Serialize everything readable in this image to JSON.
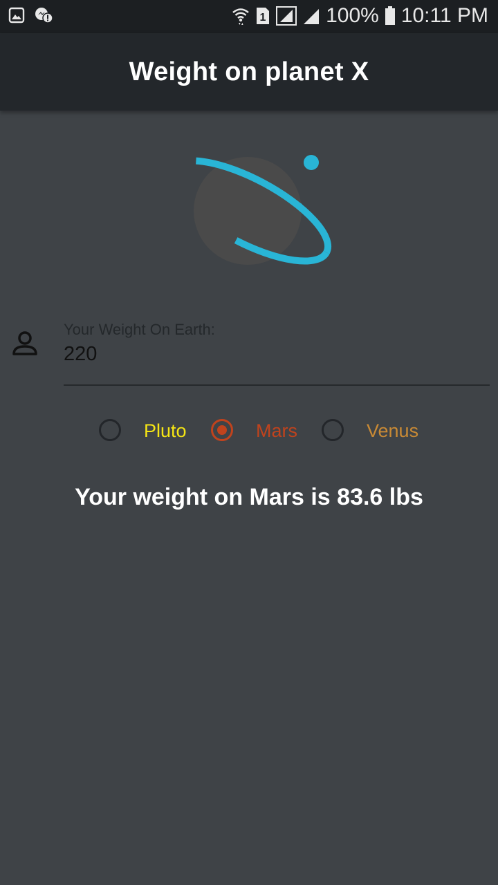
{
  "status_bar": {
    "battery_percent": "100%",
    "time": "10:11 PM",
    "sim_slot": "1",
    "left_icons": [
      "image-notification-icon",
      "messenger-alert-icon"
    ],
    "right_icons": [
      "wifi-icon",
      "sim-1-icon",
      "signal-icon",
      "signal-icon",
      "battery-icon"
    ]
  },
  "app_bar": {
    "title": "Weight on planet X"
  },
  "logo": {
    "icon": "planet-icon",
    "colors": {
      "ring": "#29b5d6",
      "planet": "#4a4a4a",
      "moon": "#29b5d6"
    }
  },
  "weight_field": {
    "icon": "person-icon",
    "label": "Your Weight On Earth:",
    "value": "220"
  },
  "planet_options": [
    {
      "label": "Pluto",
      "selected": false,
      "color": "#f5e514"
    },
    {
      "label": "Mars",
      "selected": true,
      "color": "#c0431d"
    },
    {
      "label": "Venus",
      "selected": false,
      "color": "#c98a35"
    }
  ],
  "result": {
    "text": "Your weight on Mars is 83.6 lbs"
  },
  "colors": {
    "background": "#3f4347",
    "app_bar": "#23272b",
    "status_bar": "#1c1f22"
  }
}
